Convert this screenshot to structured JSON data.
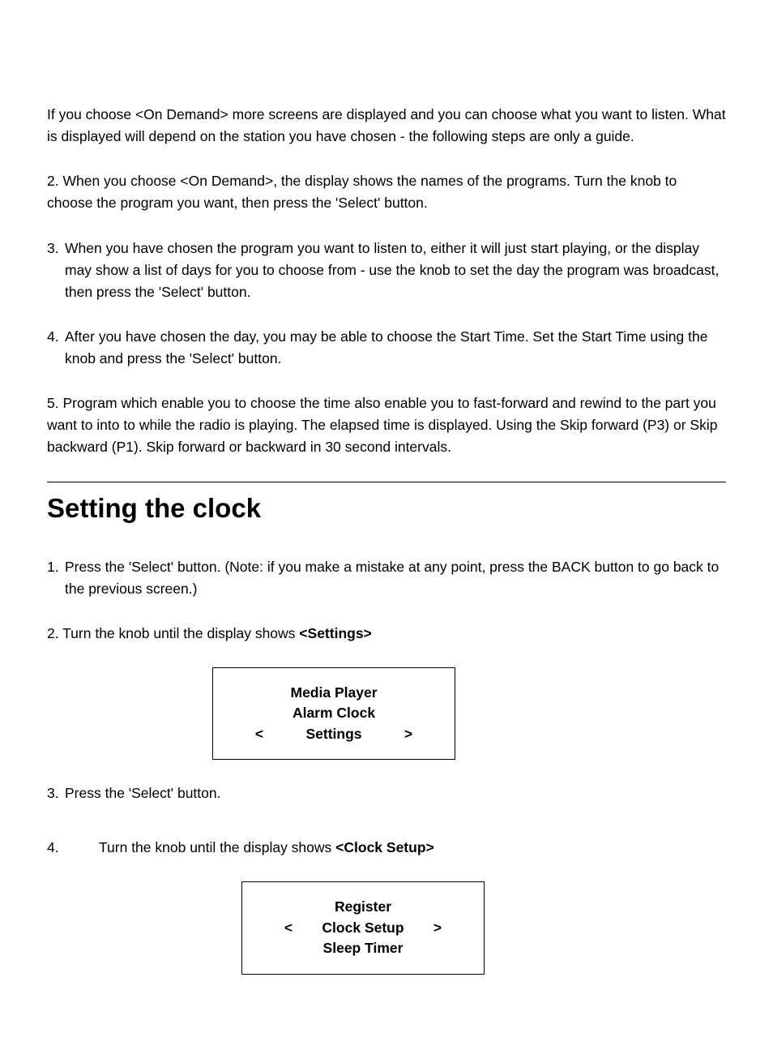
{
  "intro": {
    "p1": "If you choose <On Demand> more screens are displayed and you can choose what you want to listen. What is displayed will depend on the station you have chosen - the following steps are only a guide.",
    "p2": "2. When you choose <On Demand>, the display shows the names of the programs. Turn the knob to choose the program you want, then press the 'Select' button.",
    "p3num": "3.",
    "p3": "When you have chosen the program you want to listen to, either it will just start playing, or the display may show a list of days for you to choose from - use the knob to set the day the program was broadcast, then press the 'Select' button.",
    "p4num": "4.",
    "p4": "After you have chosen the day, you may be able to choose the Start Time. Set the Start Time using the knob and press the 'Select' button.",
    "p5": "5.  Program which enable you to choose the time also enable you to fast-forward and rewind to the part you want to into to while the radio is playing.  The elapsed time is displayed.  Using the Skip forward (P3) or Skip backward (P1).  Skip forward or backward in 30 second intervals."
  },
  "section": {
    "title": "Setting the clock",
    "s1num": "1.",
    "s1": "Press the 'Select' button. (Note: if you make a mistake at any point, press the BACK button to go back to the previous screen.)",
    "s2a": "2. Turn the knob until the display shows ",
    "s2b": "<Settings>",
    "display1": {
      "l1": "Media Player",
      "l2": "Alarm Clock",
      "l3": "Settings",
      "left": "<",
      "right": ">"
    },
    "s3num": "3.",
    "s3": "Press the 'Select' button.",
    "s4num": "4.",
    "s4a": "Turn the knob until the display shows ",
    "s4b": "<Clock Setup>",
    "display2": {
      "l1": "Register",
      "l2": "Clock Setup",
      "l3": "Sleep Timer",
      "left": "<",
      "right": ">"
    }
  }
}
